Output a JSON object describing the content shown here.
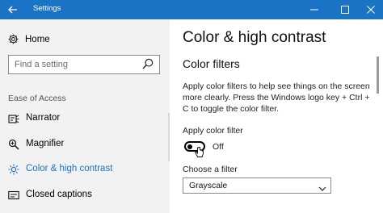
{
  "window": {
    "title": "Settings",
    "controls": {
      "minimize": "–",
      "maximize": "☐",
      "close": "✕"
    }
  },
  "sidebar": {
    "home_label": "Home",
    "search_placeholder": "Find a setting",
    "section_label": "Ease of Access",
    "items": [
      {
        "label": "Narrator",
        "icon": "narrator-icon",
        "selected": false
      },
      {
        "label": "Magnifier",
        "icon": "magnifier-icon",
        "selected": false
      },
      {
        "label": "Color & high contrast",
        "icon": "brightness-icon",
        "selected": true
      },
      {
        "label": "Closed captions",
        "icon": "captions-icon",
        "selected": false
      }
    ]
  },
  "main": {
    "page_title": "Color & high contrast",
    "section_title": "Color filters",
    "description": "Apply color filters to help see things on the screen more clearly. Press the Windows logo key + Ctrl + C to toggle the color filter.",
    "toggle_label": "Apply color filter",
    "toggle_state": "Off",
    "choose_label": "Choose a filter",
    "filter_value": "Grayscale"
  },
  "colors": {
    "accent": "#1a73c4",
    "titlebar": "#1a73c4",
    "sidebar_bg": "#f2f2f2"
  }
}
